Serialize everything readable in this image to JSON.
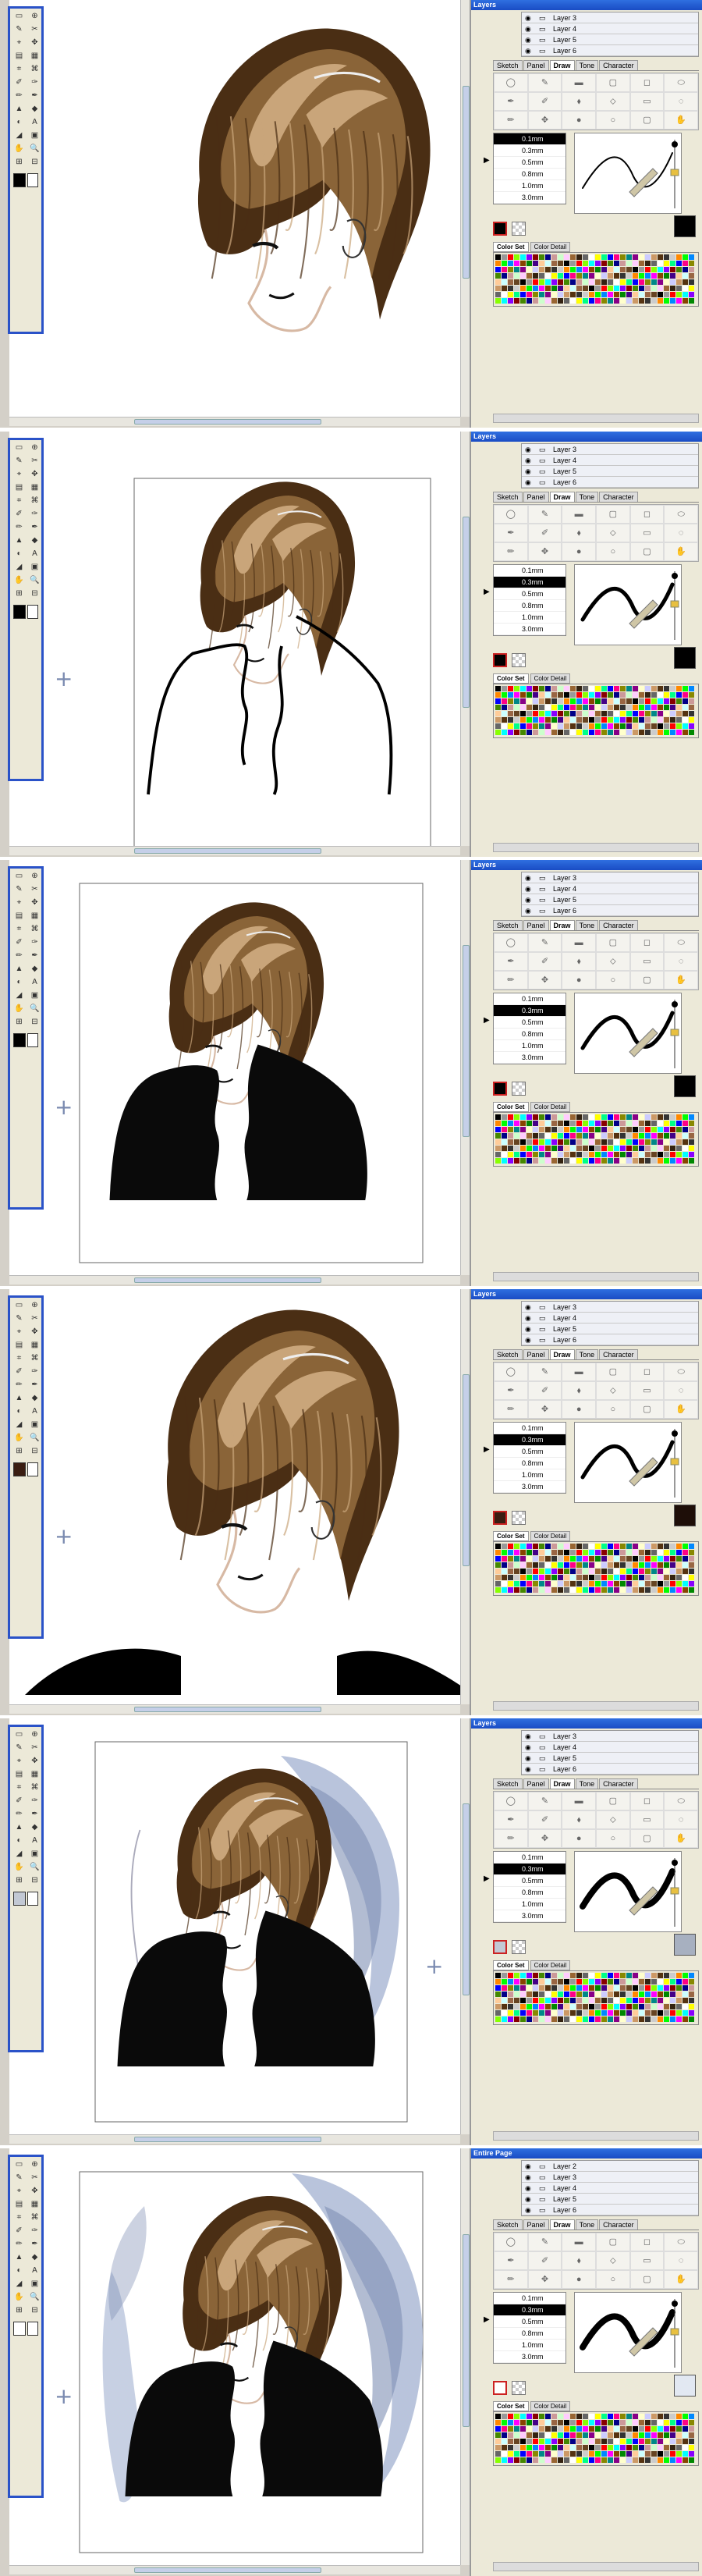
{
  "layers_title": "Layers",
  "entire_page_label": "Entire Page",
  "layers": [
    "Layer 3",
    "Layer 4",
    "Layer 5",
    "Layer 6"
  ],
  "layers_frame6": [
    "Layer 2",
    "Layer 3",
    "Layer 4",
    "Layer 5",
    "Layer 6"
  ],
  "tabs": [
    "Sketch",
    "Panel",
    "Draw",
    "Tone",
    "Character"
  ],
  "active_tab": "Draw",
  "brush_sizes": [
    "0.1mm",
    "0.3mm",
    "0.5mm",
    "0.8mm",
    "1.0mm",
    "3.0mm"
  ],
  "color_tabs": [
    "Color Set",
    "Color Detail"
  ],
  "icons": {
    "eye": "eye-icon",
    "lock": "lock-icon",
    "arrow": "arrow-right-icon"
  },
  "colors": {
    "brand_blue": "#2a52c8",
    "hair_dark": "#4a2e14",
    "hair_mid": "#8a6438",
    "hair_light": "#c9a57a",
    "skin_shadow": "#d7b9a4",
    "shirt": "#0a0a0a",
    "tone_blue": "#b9c4dc",
    "tone_dark": "#7f8fb4"
  },
  "frames": [
    {
      "selected_size": "0.1mm",
      "swatch": "#000000",
      "big_swatch": "#000000"
    },
    {
      "selected_size": "0.3mm",
      "swatch": "#000000",
      "big_swatch": "#000000"
    },
    {
      "selected_size": "0.3mm",
      "swatch": "#000000",
      "big_swatch": "#000000"
    },
    {
      "selected_size": "0.3mm",
      "swatch": "#3a1d12",
      "big_swatch": "#1e0e08"
    },
    {
      "selected_size": "0.3mm",
      "swatch": "#c2c8d4",
      "big_swatch": "#a7b0c0"
    },
    {
      "selected_size": "0.3mm",
      "swatch": "#ffffff",
      "big_swatch": "#e2e8f2"
    }
  ]
}
